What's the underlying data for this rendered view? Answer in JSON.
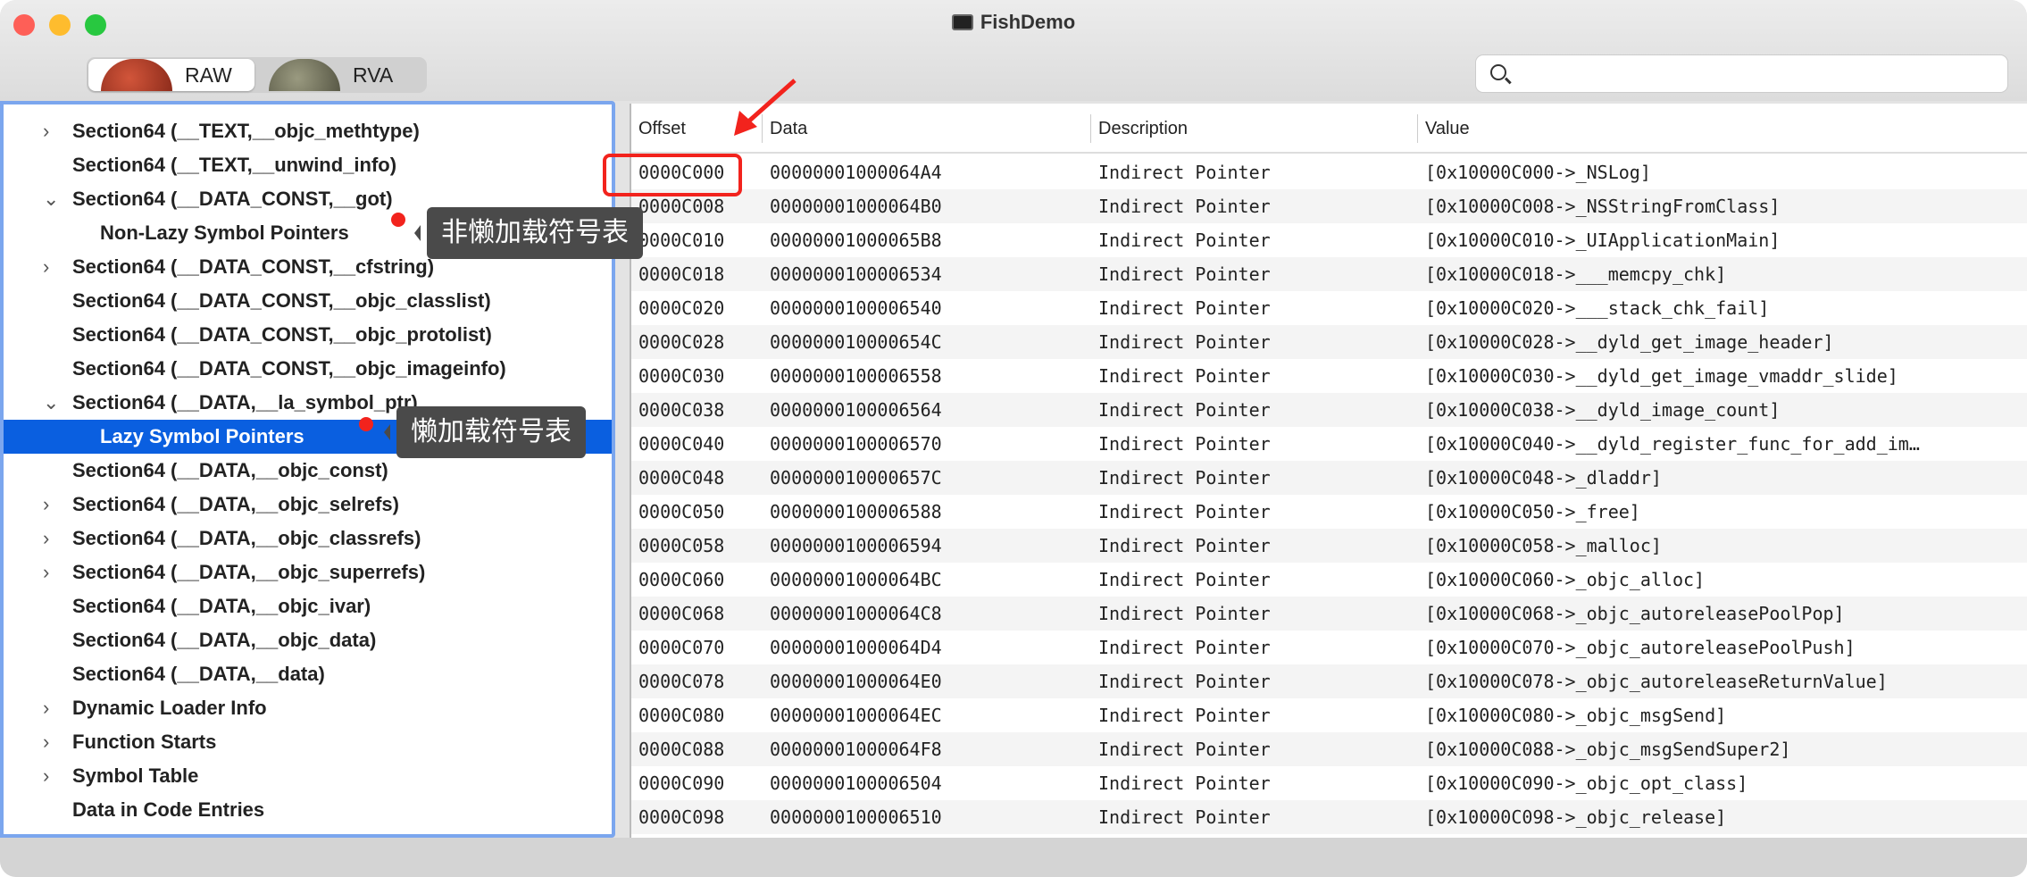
{
  "window": {
    "title": "FishDemo"
  },
  "toolbar": {
    "segments": [
      {
        "label": "RAW",
        "selected": true
      },
      {
        "label": "RVA",
        "selected": false
      }
    ],
    "search": {
      "value": "",
      "placeholder": ""
    }
  },
  "sidebar": {
    "items": [
      {
        "label": "Section64 (__TEXT,__objc_methtype)",
        "chevron": "›",
        "level": 0
      },
      {
        "label": "Section64 (__TEXT,__unwind_info)",
        "chevron": "",
        "level": 0
      },
      {
        "label": "Section64 (__DATA_CONST,__got)",
        "chevron": "⌄",
        "level": 0
      },
      {
        "label": "Non-Lazy Symbol Pointers",
        "chevron": "",
        "level": 1
      },
      {
        "label": "Section64 (__DATA_CONST,__cfstring)",
        "chevron": "›",
        "level": 0
      },
      {
        "label": "Section64 (__DATA_CONST,__objc_classlist)",
        "chevron": "",
        "level": 0
      },
      {
        "label": "Section64 (__DATA_CONST,__objc_protolist)",
        "chevron": "",
        "level": 0
      },
      {
        "label": "Section64 (__DATA_CONST,__objc_imageinfo)",
        "chevron": "",
        "level": 0
      },
      {
        "label": "Section64 (__DATA,__la_symbol_ptr)",
        "chevron": "⌄",
        "level": 0
      },
      {
        "label": "Lazy Symbol Pointers",
        "chevron": "",
        "level": 1,
        "selected": true
      },
      {
        "label": "Section64 (__DATA,__objc_const)",
        "chevron": "",
        "level": 0
      },
      {
        "label": "Section64 (__DATA,__objc_selrefs)",
        "chevron": "›",
        "level": 0
      },
      {
        "label": "Section64 (__DATA,__objc_classrefs)",
        "chevron": "›",
        "level": 0
      },
      {
        "label": "Section64 (__DATA,__objc_superrefs)",
        "chevron": "›",
        "level": 0
      },
      {
        "label": "Section64 (__DATA,__objc_ivar)",
        "chevron": "",
        "level": 0
      },
      {
        "label": "Section64 (__DATA,__objc_data)",
        "chevron": "",
        "level": 0
      },
      {
        "label": "Section64 (__DATA,__data)",
        "chevron": "",
        "level": 0
      },
      {
        "label": "Dynamic Loader Info",
        "chevron": "›",
        "level": 0
      },
      {
        "label": "Function Starts",
        "chevron": "›",
        "level": 0
      },
      {
        "label": "Symbol Table",
        "chevron": "›",
        "level": 0
      },
      {
        "label": "Data in Code Entries",
        "chevron": "",
        "level": 0
      }
    ]
  },
  "annotations": {
    "non_lazy": "非懒加载符号表",
    "lazy": "懒加载符号表",
    "accent": "#f2231d"
  },
  "table": {
    "headers": [
      "Offset",
      "Data",
      "Description",
      "Value"
    ],
    "rows": [
      [
        "0000C000",
        "00000001000064A4",
        "Indirect Pointer",
        "[0x10000C000->_NSLog]"
      ],
      [
        "0000C008",
        "00000001000064B0",
        "Indirect Pointer",
        "[0x10000C008->_NSStringFromClass]"
      ],
      [
        "0000C010",
        "00000001000065B8",
        "Indirect Pointer",
        "[0x10000C010->_UIApplicationMain]"
      ],
      [
        "0000C018",
        "0000000100006534",
        "Indirect Pointer",
        "[0x10000C018->___memcpy_chk]"
      ],
      [
        "0000C020",
        "0000000100006540",
        "Indirect Pointer",
        "[0x10000C020->___stack_chk_fail]"
      ],
      [
        "0000C028",
        "000000010000654C",
        "Indirect Pointer",
        "[0x10000C028->__dyld_get_image_header]"
      ],
      [
        "0000C030",
        "0000000100006558",
        "Indirect Pointer",
        "[0x10000C030->__dyld_get_image_vmaddr_slide]"
      ],
      [
        "0000C038",
        "0000000100006564",
        "Indirect Pointer",
        "[0x10000C038->__dyld_image_count]"
      ],
      [
        "0000C040",
        "0000000100006570",
        "Indirect Pointer",
        "[0x10000C040->__dyld_register_func_for_add_im…"
      ],
      [
        "0000C048",
        "000000010000657C",
        "Indirect Pointer",
        "[0x10000C048->_dladdr]"
      ],
      [
        "0000C050",
        "0000000100006588",
        "Indirect Pointer",
        "[0x10000C050->_free]"
      ],
      [
        "0000C058",
        "0000000100006594",
        "Indirect Pointer",
        "[0x10000C058->_malloc]"
      ],
      [
        "0000C060",
        "00000001000064BC",
        "Indirect Pointer",
        "[0x10000C060->_objc_alloc]"
      ],
      [
        "0000C068",
        "00000001000064C8",
        "Indirect Pointer",
        "[0x10000C068->_objc_autoreleasePoolPop]"
      ],
      [
        "0000C070",
        "00000001000064D4",
        "Indirect Pointer",
        "[0x10000C070->_objc_autoreleasePoolPush]"
      ],
      [
        "0000C078",
        "00000001000064E0",
        "Indirect Pointer",
        "[0x10000C078->_objc_autoreleaseReturnValue]"
      ],
      [
        "0000C080",
        "00000001000064EC",
        "Indirect Pointer",
        "[0x10000C080->_objc_msgSend]"
      ],
      [
        "0000C088",
        "00000001000064F8",
        "Indirect Pointer",
        "[0x10000C088->_objc_msgSendSuper2]"
      ],
      [
        "0000C090",
        "0000000100006504",
        "Indirect Pointer",
        "[0x10000C090->_objc_opt_class]"
      ],
      [
        "0000C098",
        "0000000100006510",
        "Indirect Pointer",
        "[0x10000C098->_objc_release]"
      ]
    ]
  }
}
